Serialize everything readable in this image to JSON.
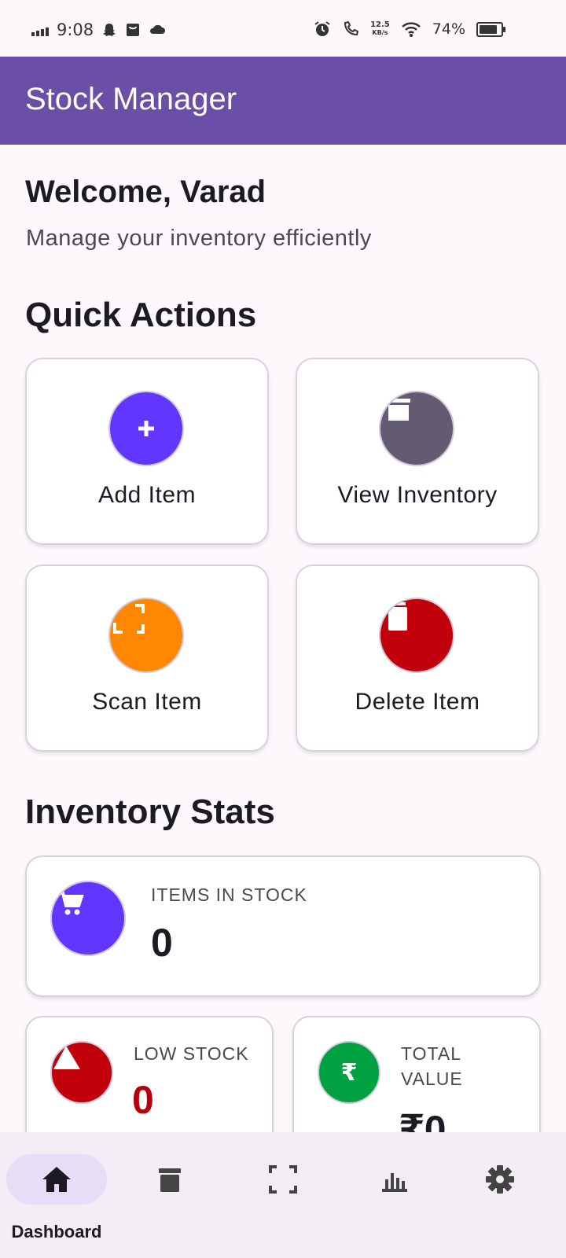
{
  "status_bar": {
    "time": "9:08",
    "speed_value": "12.5",
    "speed_unit": "KB/s",
    "battery": "74%"
  },
  "app_bar": {
    "title": "Stock Manager"
  },
  "welcome": {
    "heading": "Welcome, Varad",
    "subtitle": "Manage your inventory efficiently"
  },
  "quick_actions": {
    "title": "Quick Actions",
    "items": [
      {
        "label": "Add Item",
        "color": "#6236FF",
        "icon": "plus-icon"
      },
      {
        "label": "View Inventory",
        "color": "#625B71",
        "icon": "inventory-icon"
      },
      {
        "label": "Scan Item",
        "color": "#FF8800",
        "icon": "scan-icon"
      },
      {
        "label": "Delete Item",
        "color": "#C2000B",
        "icon": "trash-icon"
      }
    ]
  },
  "inventory_stats": {
    "title": "Inventory Stats",
    "items_in_stock": {
      "label": "ITEMS IN STOCK",
      "value": "0",
      "color": "#6236FF",
      "icon": "cart-icon"
    },
    "low_stock": {
      "label": "LOW STOCK",
      "value": "0",
      "color": "#C2000B",
      "value_color": "#B3000B",
      "icon": "warning-icon"
    },
    "total_value": {
      "label": "TOTAL VALUE",
      "value": "₹0",
      "color": "#00A140",
      "icon": "rupee-icon"
    }
  },
  "bottom_nav": {
    "items": [
      {
        "label": "Dashboard",
        "icon": "home-icon",
        "selected": true
      },
      {
        "label": "",
        "icon": "inventory-icon"
      },
      {
        "label": "",
        "icon": "scan-icon"
      },
      {
        "label": "",
        "icon": "bar-chart-icon"
      },
      {
        "label": "",
        "icon": "settings-icon"
      }
    ]
  }
}
